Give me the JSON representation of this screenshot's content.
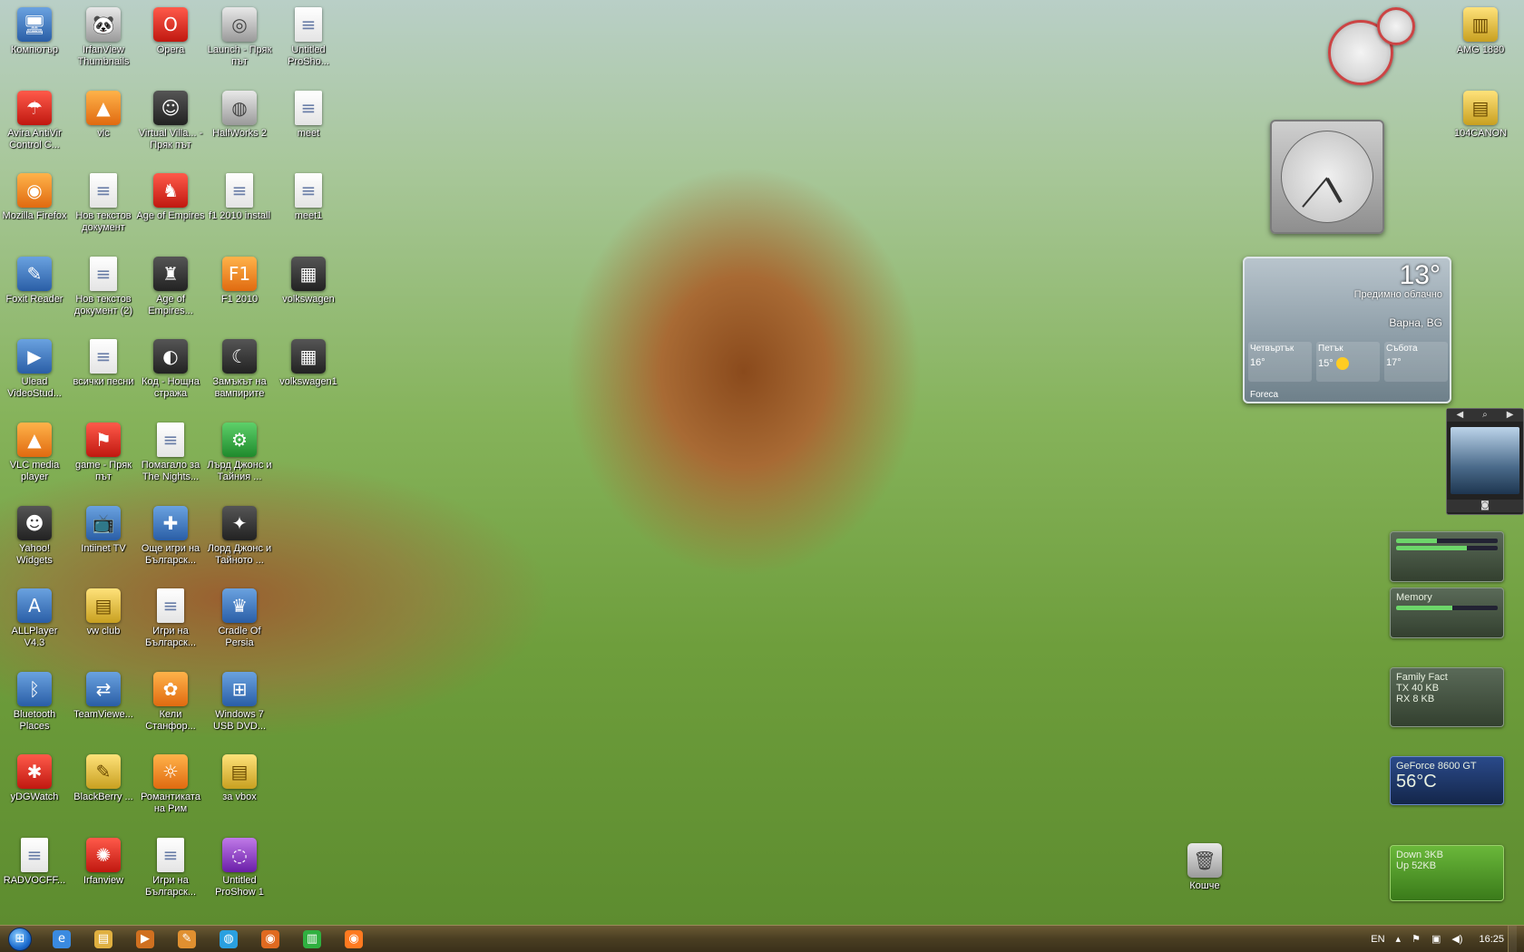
{
  "desktop": {
    "icons": [
      {
        "label": "Компютър",
        "glyph": "🖥",
        "style": "app",
        "col": 0,
        "row": 0
      },
      {
        "label": "IrfanView Thumbnails",
        "glyph": "🐼",
        "style": "gry",
        "col": 1,
        "row": 0
      },
      {
        "label": "Opera",
        "glyph": "O",
        "style": "red",
        "col": 2,
        "row": 0
      },
      {
        "label": "Launch - Пряк път",
        "glyph": "◎",
        "style": "gry",
        "col": 3,
        "row": 0
      },
      {
        "label": "Untitled ProSho...",
        "glyph": "≡",
        "style": "doc",
        "col": 4,
        "row": 0
      },
      {
        "label": "Avira AntiVir Control C...",
        "glyph": "☂",
        "style": "red",
        "col": 0,
        "row": 1
      },
      {
        "label": "vlc",
        "glyph": "▲",
        "style": "ora",
        "col": 1,
        "row": 1
      },
      {
        "label": "Virtual Villa... - Пряк път",
        "glyph": "☺",
        "style": "dark",
        "col": 2,
        "row": 1
      },
      {
        "label": "HalfWorks 2",
        "glyph": "◍",
        "style": "gry",
        "col": 3,
        "row": 1
      },
      {
        "label": "meet",
        "glyph": "≡",
        "style": "doc",
        "col": 4,
        "row": 1
      },
      {
        "label": "Mozilla Firefox",
        "glyph": "◉",
        "style": "ora",
        "col": 0,
        "row": 2
      },
      {
        "label": "Нов текстов документ",
        "glyph": "≡",
        "style": "doc",
        "col": 1,
        "row": 2
      },
      {
        "label": "Age of Empires",
        "glyph": "♞",
        "style": "red",
        "col": 2,
        "row": 2
      },
      {
        "label": "f1 2010 install",
        "glyph": "≡",
        "style": "doc",
        "col": 3,
        "row": 2
      },
      {
        "label": "meet1",
        "glyph": "≡",
        "style": "doc",
        "col": 4,
        "row": 2
      },
      {
        "label": "Foxit Reader",
        "glyph": "✎",
        "style": "app",
        "col": 0,
        "row": 3
      },
      {
        "label": "Нов текстов документ (2)",
        "glyph": "≡",
        "style": "doc",
        "col": 1,
        "row": 3
      },
      {
        "label": "Age of Empires...",
        "glyph": "♜",
        "style": "dark",
        "col": 2,
        "row": 3
      },
      {
        "label": "F1 2010",
        "glyph": "F1",
        "style": "ora",
        "col": 3,
        "row": 3
      },
      {
        "label": "volkswagen",
        "glyph": "▦",
        "style": "dark",
        "col": 4,
        "row": 3
      },
      {
        "label": "Ulead VideoStud...",
        "glyph": "▶",
        "style": "app",
        "col": 0,
        "row": 4
      },
      {
        "label": "всички песни",
        "glyph": "≡",
        "style": "doc",
        "col": 1,
        "row": 4
      },
      {
        "label": "Код - Нощна стража",
        "glyph": "◐",
        "style": "dark",
        "col": 2,
        "row": 4
      },
      {
        "label": "Замъкът на вампирите",
        "glyph": "☾",
        "style": "dark",
        "col": 3,
        "row": 4
      },
      {
        "label": "volkswagen1",
        "glyph": "▦",
        "style": "dark",
        "col": 4,
        "row": 4
      },
      {
        "label": "VLC media player",
        "glyph": "▲",
        "style": "ora",
        "col": 0,
        "row": 5
      },
      {
        "label": "game - Пряк път",
        "glyph": "⚑",
        "style": "red",
        "col": 1,
        "row": 5
      },
      {
        "label": "Помагало за The Nights...",
        "glyph": "≡",
        "style": "doc",
        "col": 2,
        "row": 5
      },
      {
        "label": "Лърд Джонс и Тайния ...",
        "glyph": "⚙",
        "style": "grn",
        "col": 3,
        "row": 5
      },
      {
        "label": "Yahoo! Widgets",
        "glyph": "☻",
        "style": "dark",
        "col": 0,
        "row": 6
      },
      {
        "label": "Intiinet TV",
        "glyph": "📺",
        "style": "app",
        "col": 1,
        "row": 6
      },
      {
        "label": "Още игри на Българск...",
        "glyph": "✚",
        "style": "app",
        "col": 2,
        "row": 6
      },
      {
        "label": "Лорд Джонс и Тайното ...",
        "glyph": "✦",
        "style": "dark",
        "col": 3,
        "row": 6
      },
      {
        "label": "ALLPlayer V4.3",
        "glyph": "A",
        "style": "app",
        "col": 0,
        "row": 7
      },
      {
        "label": "vw club",
        "glyph": "▤",
        "style": "yel",
        "col": 1,
        "row": 7
      },
      {
        "label": "Игри на Българск...",
        "glyph": "≡",
        "style": "doc",
        "col": 2,
        "row": 7
      },
      {
        "label": "Cradle Of Persia",
        "glyph": "♛",
        "style": "app",
        "col": 3,
        "row": 7
      },
      {
        "label": "Bluetooth Places",
        "glyph": "ᛒ",
        "style": "app",
        "col": 0,
        "row": 8
      },
      {
        "label": "TeamViewe...",
        "glyph": "⇄",
        "style": "app",
        "col": 1,
        "row": 8
      },
      {
        "label": "Кели Станфор...",
        "glyph": "✿",
        "style": "ora",
        "col": 2,
        "row": 8
      },
      {
        "label": "Windows 7 USB DVD...",
        "glyph": "⊞",
        "style": "app",
        "col": 3,
        "row": 8
      },
      {
        "label": "yDGWatch",
        "glyph": "✱",
        "style": "red",
        "col": 0,
        "row": 9
      },
      {
        "label": "BlackBerry ...",
        "glyph": "✎",
        "style": "yel",
        "col": 1,
        "row": 9
      },
      {
        "label": "Романтиката на Рим",
        "glyph": "☼",
        "style": "ora",
        "col": 2,
        "row": 9
      },
      {
        "label": "за vbox",
        "glyph": "▤",
        "style": "yel",
        "col": 3,
        "row": 9
      },
      {
        "label": "RADVOCFF...",
        "glyph": "≡",
        "style": "doc",
        "col": 0,
        "row": 10
      },
      {
        "label": "Irfanview",
        "glyph": "✺",
        "style": "red",
        "col": 1,
        "row": 10
      },
      {
        "label": "Игри на Българск...",
        "glyph": "≡",
        "style": "doc",
        "col": 2,
        "row": 10
      },
      {
        "label": "Untitled ProShow 1",
        "glyph": "◌",
        "style": "pur",
        "col": 3,
        "row": 10
      }
    ],
    "right_icons": [
      {
        "label": "AMG 1830",
        "glyph": "▥",
        "style": "yel"
      },
      {
        "label": "104CANON",
        "glyph": "▤",
        "style": "yel"
      }
    ],
    "recycle_bin": {
      "label": "Кошче",
      "glyph": "🗑"
    }
  },
  "gadgets": {
    "weather": {
      "temperature": "13°",
      "condition": "Предимно облачно",
      "city": "Варна, BG",
      "days": [
        {
          "name": "Четвъртък",
          "temp": "16°"
        },
        {
          "name": "Петък",
          "temp": "15°"
        },
        {
          "name": "Събота",
          "temp": "17°"
        }
      ],
      "source": "Foreca"
    },
    "memory": {
      "title": "Memory",
      "used_fraction": 0.55
    },
    "network": {
      "title": "Family Fact",
      "tx": "TX 40 KB",
      "rx": "RX 8 KB"
    },
    "gpu": {
      "title": "GeForce 8600 GT",
      "temp": "56°C"
    },
    "bandwidth": {
      "down": "Down 3KB",
      "up": "Up 52KB"
    }
  },
  "taskbar": {
    "start_glyph": "⊞",
    "pinned": [
      {
        "name": "ie",
        "glyph": "e",
        "color": "#3a8ae0"
      },
      {
        "name": "explorer",
        "glyph": "▤",
        "color": "#e0b040"
      },
      {
        "name": "media",
        "glyph": "▶",
        "color": "#d07020"
      },
      {
        "name": "tool",
        "glyph": "✎",
        "color": "#e09030"
      },
      {
        "name": "skype",
        "glyph": "◍",
        "color": "#2aa0e0"
      },
      {
        "name": "firefox2",
        "glyph": "◉",
        "color": "#e06a20"
      },
      {
        "name": "chart",
        "glyph": "▥",
        "color": "#30b040"
      },
      {
        "name": "firefox",
        "glyph": "◉",
        "color": "#ff7a20"
      }
    ],
    "tray": {
      "language": "EN",
      "time": "16:25"
    }
  }
}
